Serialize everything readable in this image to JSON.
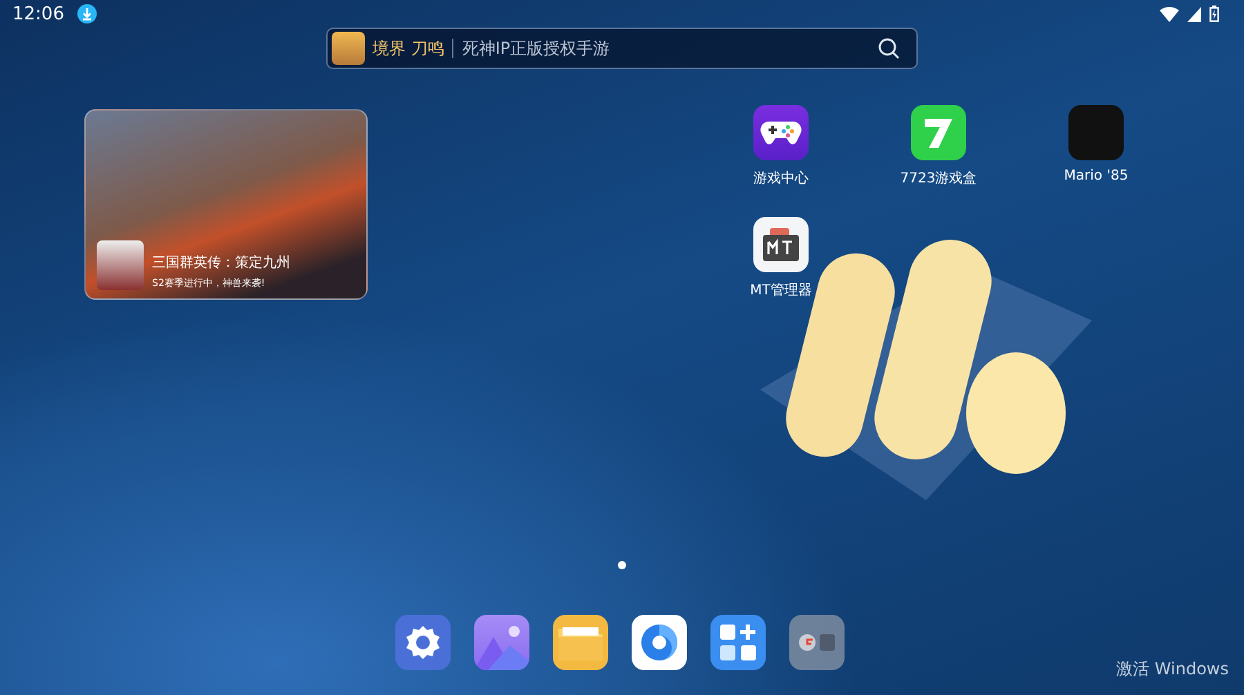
{
  "status_bar": {
    "time": "12:06"
  },
  "search_bar": {
    "game_name": "境界 刀鸣",
    "slogan": "死神IP正版授权手游"
  },
  "widget": {
    "title": "三国群英传：策定九州",
    "subtitle": "S2赛季进行中，神兽来袭!"
  },
  "apps": [
    {
      "label": "游戏中心",
      "kind": "gamepad"
    },
    {
      "label": "7723游戏盒",
      "kind": "seven"
    },
    {
      "label": "Mario '85",
      "kind": "dark"
    },
    {
      "label": "MT管理器",
      "kind": "mt"
    }
  ],
  "pages": [
    {
      "selected": true
    }
  ],
  "dock": [
    {
      "kind": "settings"
    },
    {
      "kind": "gallery"
    },
    {
      "kind": "files"
    },
    {
      "kind": "browser"
    },
    {
      "kind": "store"
    },
    {
      "kind": "folder"
    }
  ],
  "activation_notice": {
    "title": "激活 Windows"
  }
}
